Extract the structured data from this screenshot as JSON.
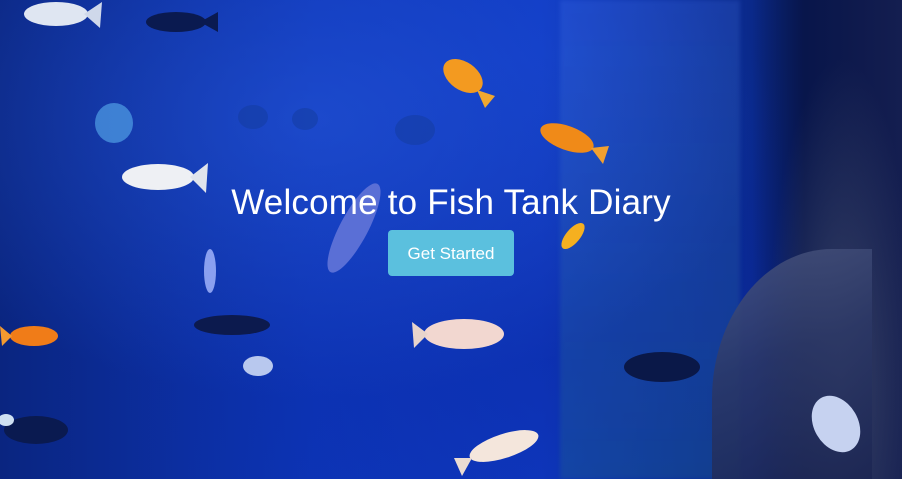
{
  "hero": {
    "title": "Welcome to Fish Tank Diary",
    "button_label": "Get Started",
    "background_image": "aquarium-fish-photo"
  },
  "colors": {
    "button_background": "#5bc0de",
    "text": "#ffffff",
    "water_blue": "#0d35b8"
  }
}
